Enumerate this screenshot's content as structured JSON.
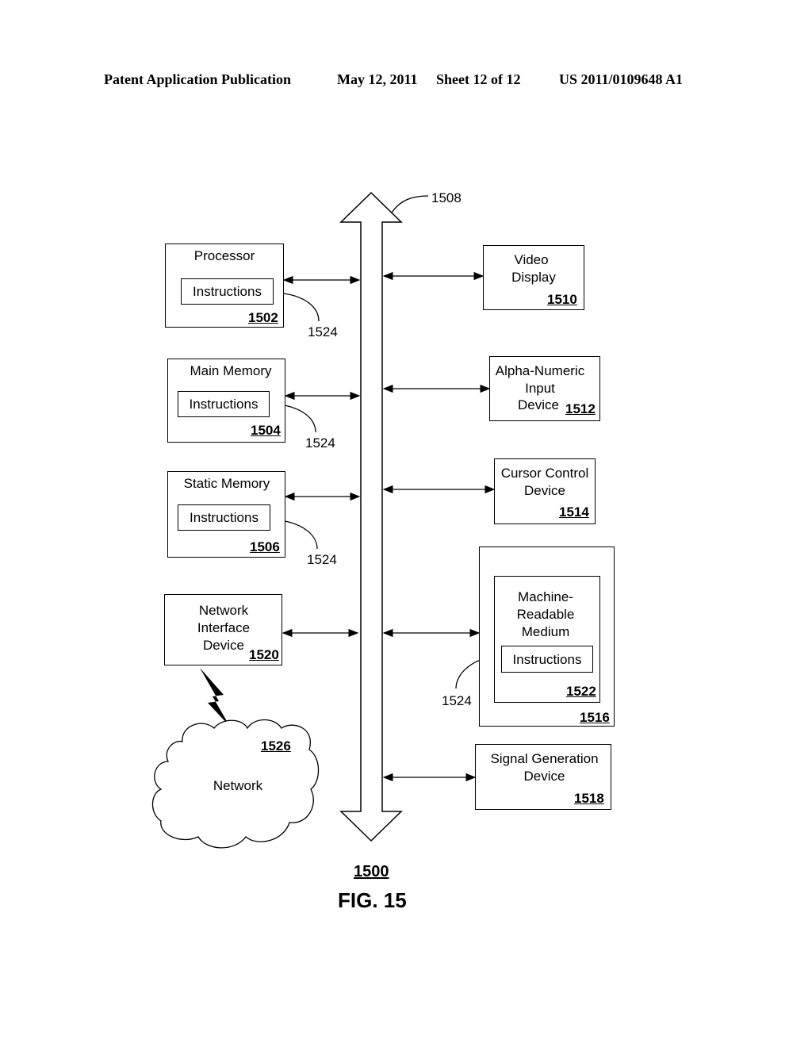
{
  "header": {
    "publication": "Patent Application Publication",
    "date": "May 12, 2011",
    "sheet": "Sheet 12 of 12",
    "number": "US 2011/0109648 A1"
  },
  "bus": {
    "ref": "1508"
  },
  "left_blocks": [
    {
      "title": "Processor",
      "inner": "Instructions",
      "ref": "1502",
      "callout": "1524"
    },
    {
      "title": "Main Memory",
      "inner": "Instructions",
      "ref": "1504",
      "callout": "1524"
    },
    {
      "title": "Static Memory",
      "inner": "Instructions",
      "ref": "1506",
      "callout": "1524"
    },
    {
      "title_lines": [
        "Network",
        "Interface",
        "Device"
      ],
      "ref": "1520"
    }
  ],
  "right_blocks": [
    {
      "title_lines": [
        "Video",
        "Display"
      ],
      "ref": "1510"
    },
    {
      "title_lines": [
        "Alpha-Numeric",
        "Input",
        "Device"
      ],
      "ref": "1512"
    },
    {
      "title_lines": [
        "Cursor Control",
        "Device"
      ],
      "ref": "1514"
    },
    {
      "outer_ref": "1516",
      "title_lines": [
        "Machine-",
        "Readable",
        "Medium"
      ],
      "inner": "Instructions",
      "ref": "1522",
      "callout": "1524"
    },
    {
      "title_lines": [
        "Signal Generation",
        "Device"
      ],
      "ref": "1518"
    }
  ],
  "network": {
    "label": "Network",
    "ref": "1526"
  },
  "figure": {
    "ref": "1500",
    "caption": "FIG. 15"
  }
}
